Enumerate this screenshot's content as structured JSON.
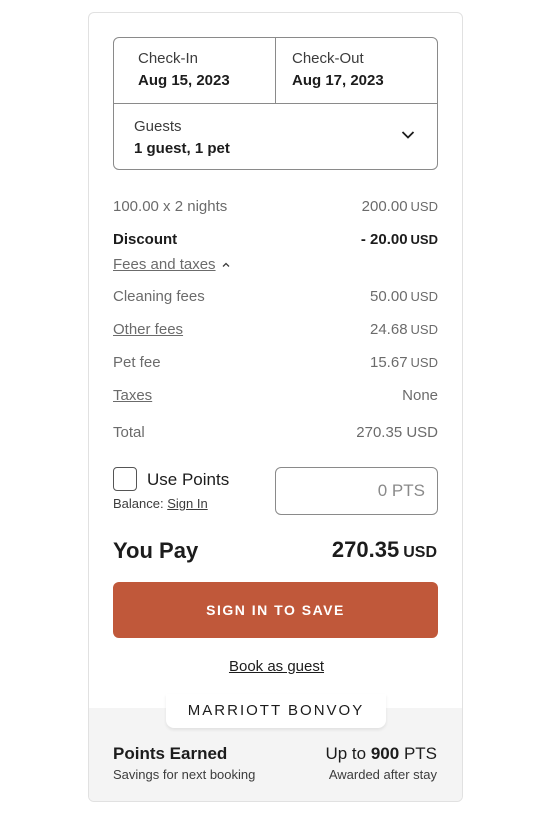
{
  "booking": {
    "check_in_label": "Check-In",
    "check_in_date": "Aug 15, 2023",
    "check_out_label": "Check-Out",
    "check_out_date": "Aug 17, 2023",
    "guests_label": "Guests",
    "guests_value": "1 guest, 1 pet"
  },
  "pricing": {
    "nightly_label": "100.00 x 2 nights",
    "nightly_amount": "200.00",
    "discount_label": "Discount",
    "discount_amount": "- 20.00",
    "fees_toggle_label": "Fees and taxes",
    "cleaning_label": "Cleaning fees",
    "cleaning_amount": "50.00",
    "other_label": "Other fees",
    "other_amount": "24.68",
    "pet_label": "Pet fee",
    "pet_amount": "15.67",
    "taxes_label": "Taxes",
    "taxes_value": "None",
    "total_label": "Total",
    "total_amount": "270.35 USD",
    "currency": "USD"
  },
  "points": {
    "use_points_label": "Use Points",
    "balance_label": "Balance:",
    "sign_in_link": "Sign In",
    "input_placeholder": "0 PTS"
  },
  "payment": {
    "you_pay_label": "You Pay",
    "you_pay_amount": "270.35",
    "currency": "USD",
    "cta_label": "SIGN IN TO SAVE",
    "guest_link": "Book as guest"
  },
  "footer": {
    "brand": "MARRIOTT BONVOY",
    "points_earned_title": "Points Earned",
    "points_earned_sub": "Savings for next booking",
    "up_to_prefix": "Up to",
    "up_to_value": "900",
    "up_to_unit": "PTS",
    "awarded_note": "Awarded after stay"
  },
  "colors": {
    "accent": "#c0583a",
    "footer_bg": "#f4f4f4"
  }
}
